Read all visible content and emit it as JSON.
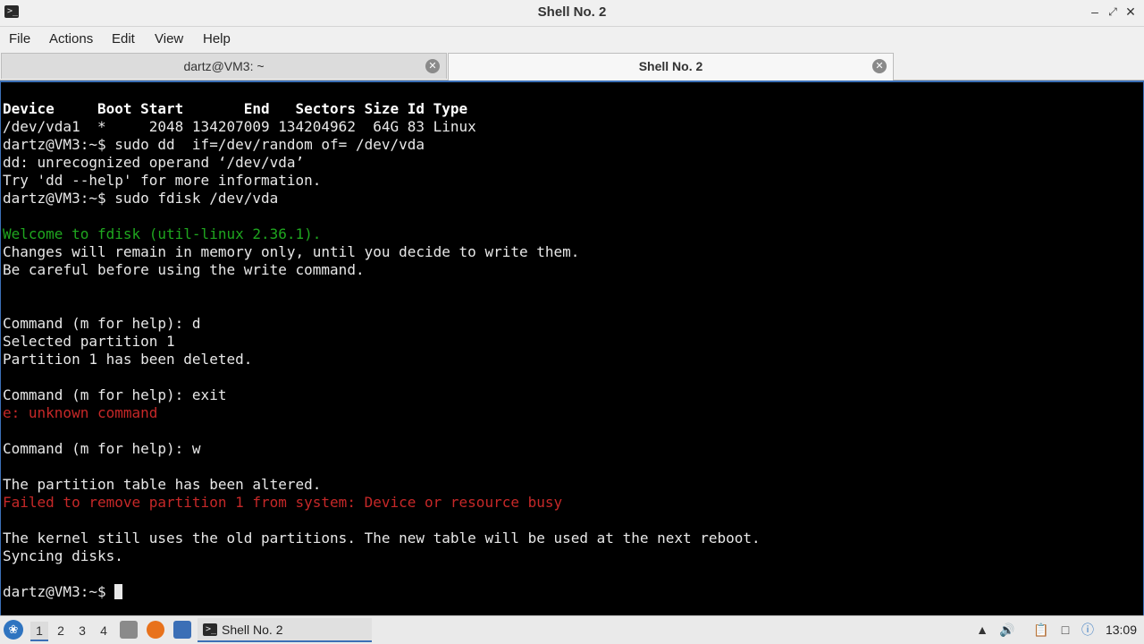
{
  "window": {
    "title": "Shell No. 2",
    "app_icon": "terminal-icon",
    "controls": [
      "minimize",
      "maximize",
      "close"
    ]
  },
  "menu": [
    "File",
    "Actions",
    "Edit",
    "View",
    "Help"
  ],
  "tabs": [
    {
      "label": "dartz@VM3: ~",
      "active": false
    },
    {
      "label": "Shell No. 2",
      "active": true
    }
  ],
  "terminal": {
    "lines": [
      {
        "text": "Device     Boot Start       End   Sectors Size Id Type",
        "style": "bold"
      },
      {
        "text": "/dev/vda1  *     2048 134207009 134204962  64G 83 Linux",
        "style": "normal"
      },
      {
        "text": "dartz@VM3:~$ sudo dd  if=/dev/random of= /dev/vda",
        "style": "normal"
      },
      {
        "text": "dd: unrecognized operand ‘/dev/vda’",
        "style": "normal"
      },
      {
        "text": "Try 'dd --help' for more information.",
        "style": "normal"
      },
      {
        "text": "dartz@VM3:~$ sudo fdisk /dev/vda",
        "style": "normal"
      },
      {
        "text": "",
        "style": "normal"
      },
      {
        "text": "Welcome to fdisk (util-linux 2.36.1).",
        "style": "green"
      },
      {
        "text": "Changes will remain in memory only, until you decide to write them.",
        "style": "normal"
      },
      {
        "text": "Be careful before using the write command.",
        "style": "normal"
      },
      {
        "text": "",
        "style": "normal"
      },
      {
        "text": "",
        "style": "normal"
      },
      {
        "text": "Command (m for help): d",
        "style": "normal"
      },
      {
        "text": "Selected partition 1",
        "style": "normal"
      },
      {
        "text": "Partition 1 has been deleted.",
        "style": "normal"
      },
      {
        "text": "",
        "style": "normal"
      },
      {
        "text": "Command (m for help): exit",
        "style": "normal"
      },
      {
        "text": "e: unknown command",
        "style": "red"
      },
      {
        "text": "",
        "style": "normal"
      },
      {
        "text": "Command (m for help): w",
        "style": "normal"
      },
      {
        "text": "",
        "style": "normal"
      },
      {
        "text": "The partition table has been altered.",
        "style": "normal"
      },
      {
        "text": "Failed to remove partition 1 from system: Device or resource busy",
        "style": "red"
      },
      {
        "text": "",
        "style": "normal"
      },
      {
        "text": "The kernel still uses the old partitions. The new table will be used at the next reboot.",
        "style": "normal"
      },
      {
        "text": "Syncing disks.",
        "style": "normal"
      },
      {
        "text": "",
        "style": "normal"
      }
    ],
    "prompt": "dartz@VM3:~$ "
  },
  "taskbar": {
    "workspaces": [
      "1",
      "2",
      "3",
      "4"
    ],
    "active_workspace": "1",
    "quick_launch": [
      "file-manager-icon",
      "firefox-icon",
      "desktop-icon"
    ],
    "task": {
      "label": "Shell No. 2",
      "icon": "terminal-icon"
    },
    "tray": [
      "tray-up-arrow-icon",
      "volume-icon",
      "clipboard-icon",
      "network-icon",
      "update-notifier-icon"
    ],
    "clock": "13:09"
  },
  "colors": {
    "accent": "#3b6fb6",
    "terminal_bg": "#000000",
    "terminal_fg": "#e8e8e8",
    "green": "#1fa61f",
    "red": "#c62828"
  }
}
